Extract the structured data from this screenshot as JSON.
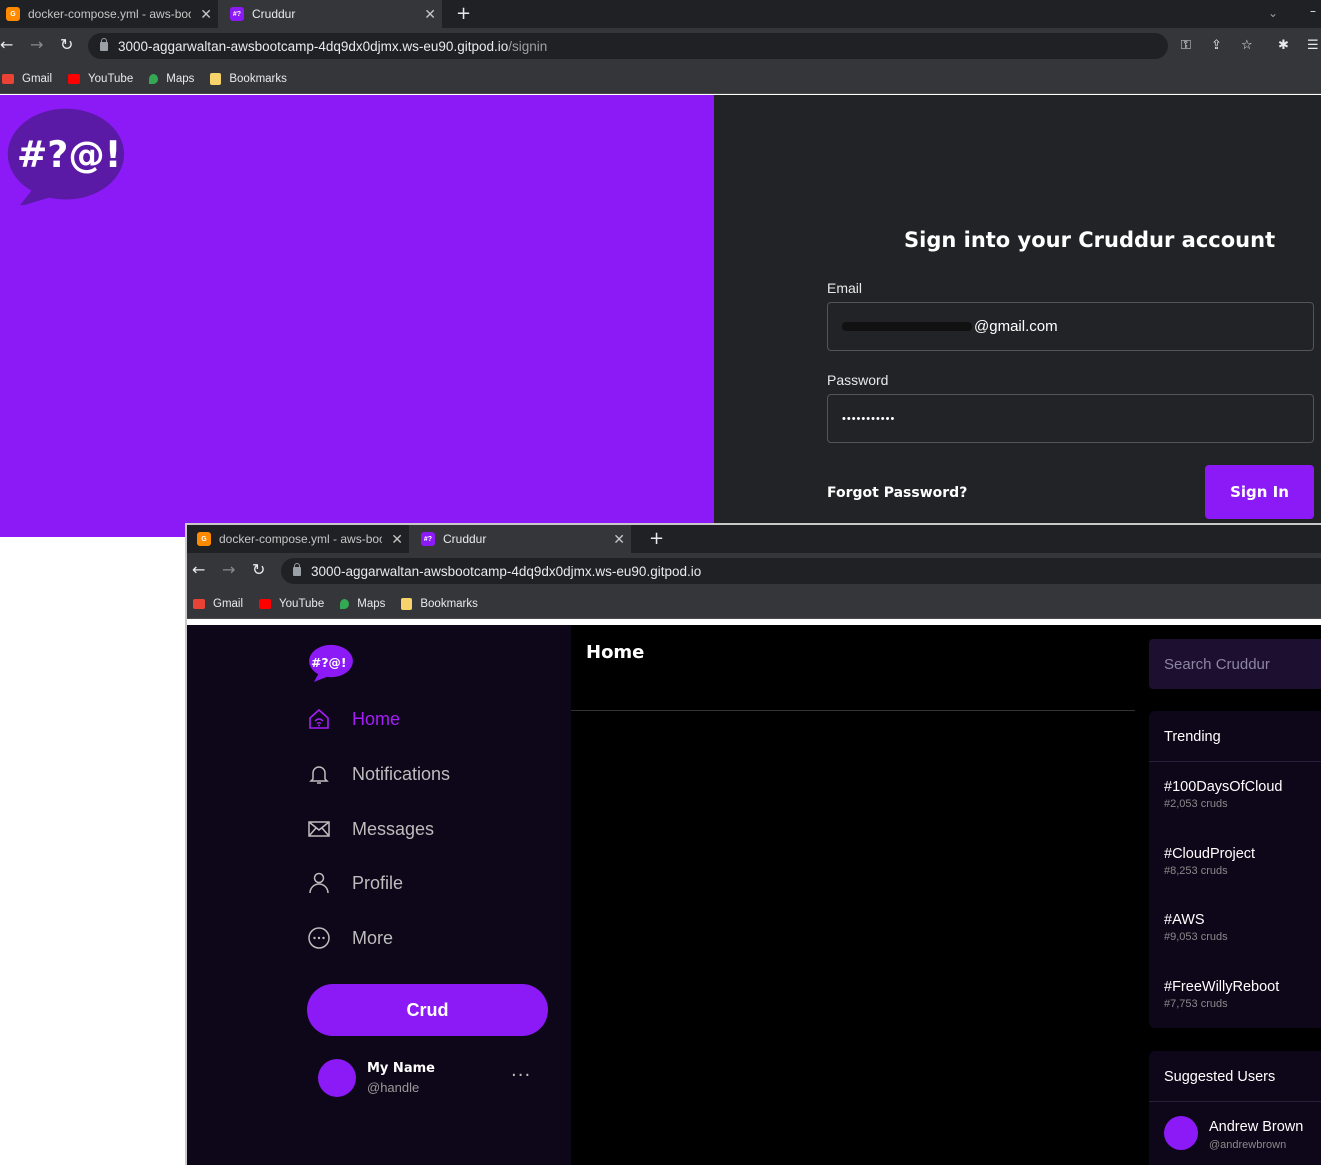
{
  "browser": {
    "tabs": [
      {
        "title": "docker-compose.yml - aws-bootc",
        "favicon": "gitpod-icon"
      },
      {
        "title": "Cruddur",
        "favicon": "cruddur-icon"
      }
    ],
    "url_host": "3000-aggarwaltan-awsbootcamp-4dq9dx0djmx.ws-eu90.gitpod.io",
    "url_path_signin": "/signin",
    "bookmarks": [
      {
        "label": "Gmail",
        "icon": "gmail-icon"
      },
      {
        "label": "YouTube",
        "icon": "youtube-icon"
      },
      {
        "label": "Maps",
        "icon": "maps-icon"
      },
      {
        "label": "Bookmarks",
        "icon": "bookmark-folder-icon"
      }
    ]
  },
  "logo_text": "#?@!",
  "signin": {
    "title": "Sign into your Cruddur account",
    "email_label": "Email",
    "email_value": "@gmail.com",
    "password_label": "Password",
    "password_value": "•••••••••••",
    "forgot": "Forgot Password?",
    "submit": "Sign In"
  },
  "home": {
    "nav": [
      {
        "label": "Home",
        "icon": "home-icon",
        "active": true
      },
      {
        "label": "Notifications",
        "icon": "bell-icon"
      },
      {
        "label": "Messages",
        "icon": "envelope-icon"
      },
      {
        "label": "Profile",
        "icon": "person-icon"
      },
      {
        "label": "More",
        "icon": "more-circle-icon"
      }
    ],
    "crud_button": "Crud",
    "user": {
      "name": "My Name",
      "handle": "@handle",
      "menu": "···"
    },
    "main_title": "Home",
    "search_placeholder": "Search Cruddur",
    "trending_title": "Trending",
    "trending": [
      {
        "tag": "#100DaysOfCloud",
        "count": "#2,053 cruds"
      },
      {
        "tag": "#CloudProject",
        "count": "#8,253 cruds"
      },
      {
        "tag": "#AWS",
        "count": "#9,053 cruds"
      },
      {
        "tag": "#FreeWillyReboot",
        "count": "#7,753 cruds"
      }
    ],
    "suggested_title": "Suggested Users",
    "suggested": [
      {
        "name": "Andrew Brown",
        "handle": "@andrewbrown"
      }
    ]
  },
  "colors": {
    "accent": "#8c1af6",
    "active_nav": "#a51ef9",
    "panel": "#0e0619"
  }
}
